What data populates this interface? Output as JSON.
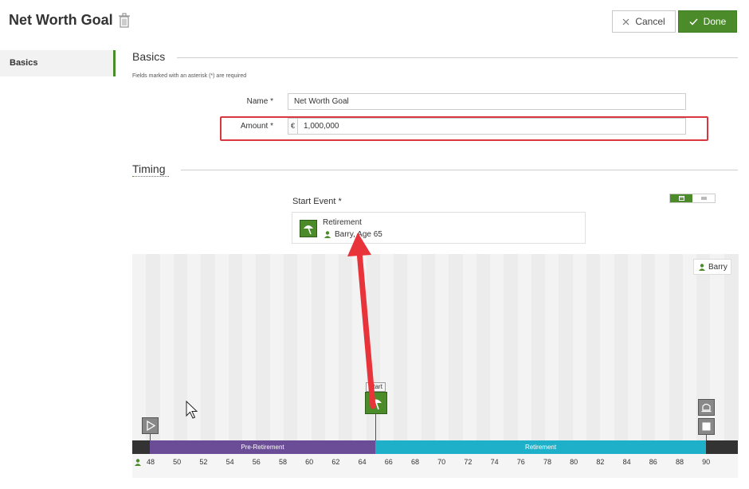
{
  "header": {
    "title": "Net Worth Goal",
    "cancel_label": "Cancel",
    "done_label": "Done"
  },
  "sidebar": {
    "items": [
      {
        "label": "Basics",
        "active": true
      }
    ]
  },
  "basics": {
    "section_title": "Basics",
    "required_note": "Fields marked with an asterisk (*) are required",
    "name_label": "Name *",
    "name_value": "Net Worth Goal",
    "amount_label": "Amount *",
    "currency_symbol": "€",
    "amount_value": "1,000,000"
  },
  "timing": {
    "section_title": "Timing",
    "start_event_label": "Start Event *",
    "event_name": "Retirement",
    "event_person": "Barry, Age 65",
    "person_badge": "Barry",
    "start_tag": "Start",
    "phases": [
      {
        "label": "Pre-Retirement",
        "color": "#6b4c96"
      },
      {
        "label": "Retirement",
        "color": "#1fb0c9"
      }
    ],
    "ages": [
      "48",
      "50",
      "52",
      "54",
      "56",
      "58",
      "60",
      "62",
      "64",
      "66",
      "68",
      "70",
      "72",
      "74",
      "76",
      "78",
      "80",
      "82",
      "84",
      "86",
      "88",
      "90"
    ]
  },
  "colors": {
    "accent": "#4b8b2a",
    "highlight": "#d9373f"
  }
}
